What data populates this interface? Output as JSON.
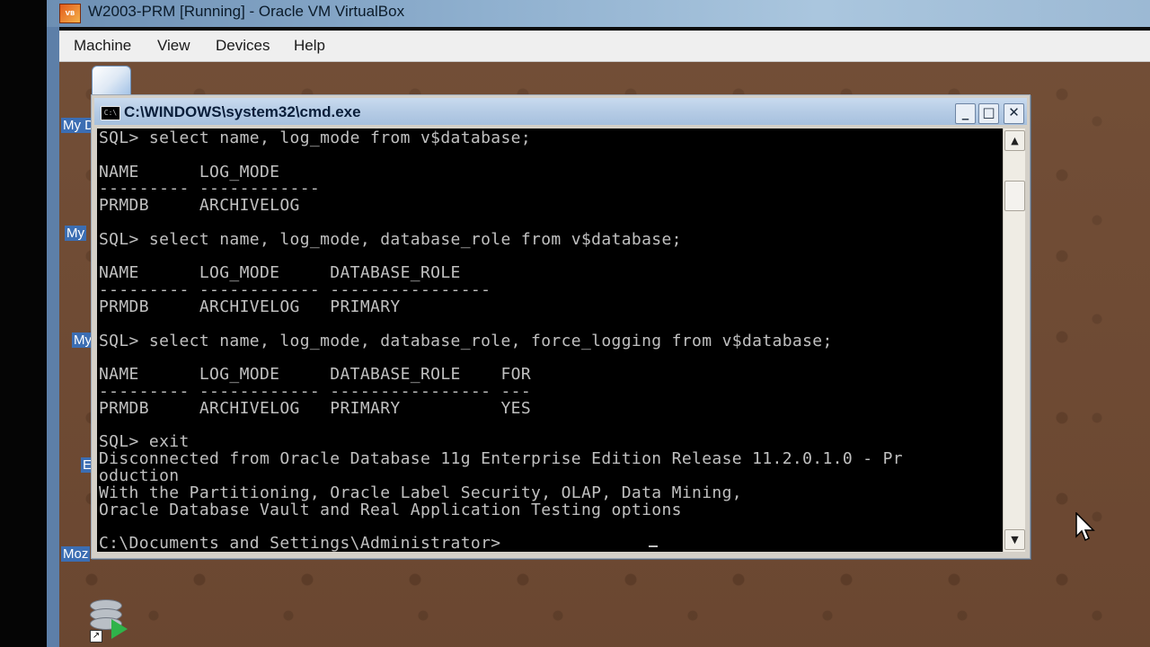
{
  "host_window": {
    "title": "W2003-PRM [Running] - Oracle VM VirtualBox",
    "icon": "virtualbox-icon"
  },
  "menubar": {
    "items": [
      "Machine",
      "View",
      "Devices",
      "Help"
    ]
  },
  "desktop": {
    "labels": [
      "My D",
      "My",
      "My",
      "E",
      "Moz"
    ]
  },
  "cmd_window": {
    "title": "C:\\WINDOWS\\system32\\cmd.exe",
    "icon_glyph": "C:\\",
    "buttons": {
      "minimize": "_",
      "maximize": "□",
      "close": "✕"
    }
  },
  "console": {
    "lines": [
      "SQL> select name, log_mode from v$database;",
      "",
      "NAME      LOG_MODE",
      "--------- ------------",
      "PRMDB     ARCHIVELOG",
      "",
      "SQL> select name, log_mode, database_role from v$database;",
      "",
      "NAME      LOG_MODE     DATABASE_ROLE",
      "--------- ------------ ----------------",
      "PRMDB     ARCHIVELOG   PRIMARY",
      "",
      "SQL> select name, log_mode, database_role, force_logging from v$database;",
      "",
      "NAME      LOG_MODE     DATABASE_ROLE    FOR",
      "--------- ------------ ---------------- ---",
      "PRMDB     ARCHIVELOG   PRIMARY          YES",
      "",
      "SQL> exit",
      "Disconnected from Oracle Database 11g Enterprise Edition Release 11.2.0.1.0 - Pr",
      "oduction",
      "With the Partitioning, Oracle Label Security, OLAP, Data Mining,",
      "Oracle Database Vault and Real Application Testing options",
      "",
      "C:\\Documents and Settings\\Administrator>"
    ]
  },
  "scrollbar": {
    "up": "▲",
    "down": "▼"
  }
}
